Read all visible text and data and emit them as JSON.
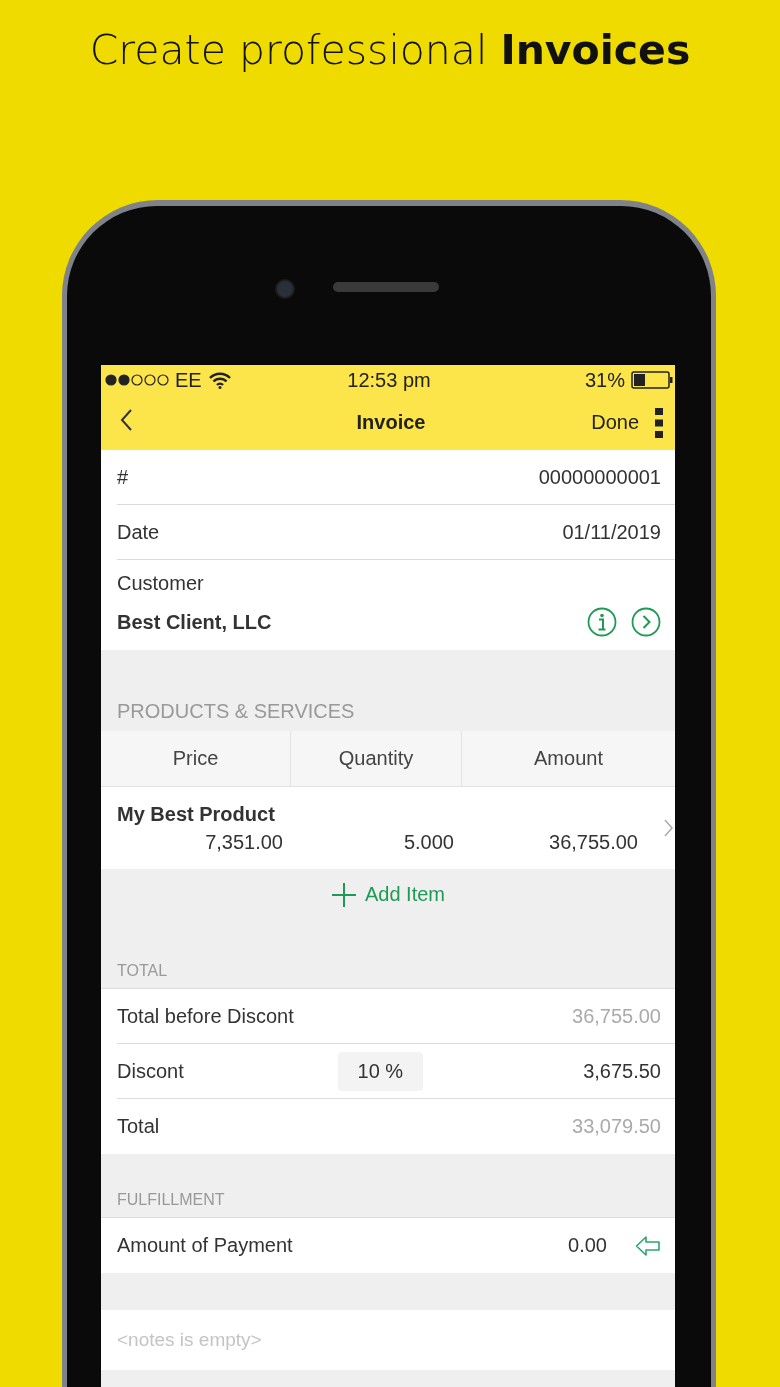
{
  "headline": "Create professional **Invoices**",
  "status_bar": {
    "carrier": "EE",
    "time": "12:53 pm",
    "battery": "31%"
  },
  "nav": {
    "title": "Invoice",
    "done": "Done"
  },
  "header_fields": [
    {
      "label": "#",
      "value": "00000000001"
    },
    {
      "label": "Date",
      "value": "01/11/2019"
    }
  ],
  "customer": {
    "label": "Customer",
    "name": "Best Client, LLC"
  },
  "products": {
    "section": "PRODUCTS & SERVICES",
    "columns": [
      "Price",
      "Quantity",
      "Amount"
    ],
    "rows": [
      {
        "name": "My Best Product",
        "price": "7,351.00",
        "quantity": "5.000",
        "amount": "36,755.00"
      }
    ],
    "add": "Add Item"
  },
  "total": {
    "section": "TOTAL",
    "before_label": "Total before Discont",
    "before_value": "36,755.00",
    "discount_label": "Discont",
    "discount_rate": "10 %",
    "discount_value": "3,675.50",
    "total_label": "Total",
    "total_value": "33,079.50"
  },
  "fulfillment": {
    "section": "FULFILLMENT",
    "payment_label": "Amount of Payment",
    "payment_value": "0.00"
  },
  "notes": {
    "placeholder": "<notes is empty>"
  }
}
